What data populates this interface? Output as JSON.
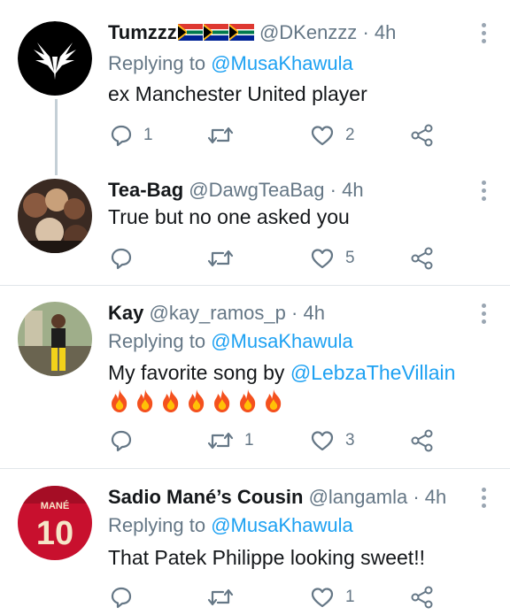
{
  "tweets": [
    {
      "display_name": "Tumzzz",
      "handle": "@DKenzzz",
      "dot": "·",
      "time": "4h",
      "reply_prefix": "Replying to",
      "reply_to": "@MusaKhawula",
      "text": "ex Manchester United player",
      "replies": "1",
      "retweets": "",
      "likes": "2"
    },
    {
      "display_name": "Tea-Bag",
      "handle": "@DawgTeaBag",
      "dot": "·",
      "time": "4h",
      "text": "True but no one asked you",
      "replies": "",
      "retweets": "",
      "likes": "5"
    },
    {
      "display_name": "Kay",
      "handle": "@kay_ramos_p",
      "dot": "·",
      "time": "4h",
      "reply_prefix": "Replying to",
      "reply_to": "@MusaKhawula",
      "text_prefix": "My favorite song by",
      "text_mention": "@LebzaTheVillain",
      "emoji": "🔥🔥🔥🔥🔥🔥🔥",
      "replies": "",
      "retweets": "1",
      "likes": "3"
    },
    {
      "display_name": "Sadio Mané’s Cousin",
      "handle": "@langamla",
      "dot": "·",
      "time": "4h",
      "reply_prefix": "Replying to",
      "reply_to": "@MusaKhawula",
      "text": "That Patek Philippe looking sweet!!",
      "replies": "",
      "retweets": "",
      "likes": "1",
      "avatar_name": "MANÉ",
      "avatar_number": "10"
    }
  ],
  "colors": {
    "accent": "#1da1f2",
    "secondary_text": "#657786",
    "divider": "#e1e6ea"
  },
  "icons": [
    "reply-icon",
    "retweet-icon",
    "like-icon",
    "share-icon",
    "more-options-icon",
    "fire-emoji",
    "south-africa-flag"
  ]
}
